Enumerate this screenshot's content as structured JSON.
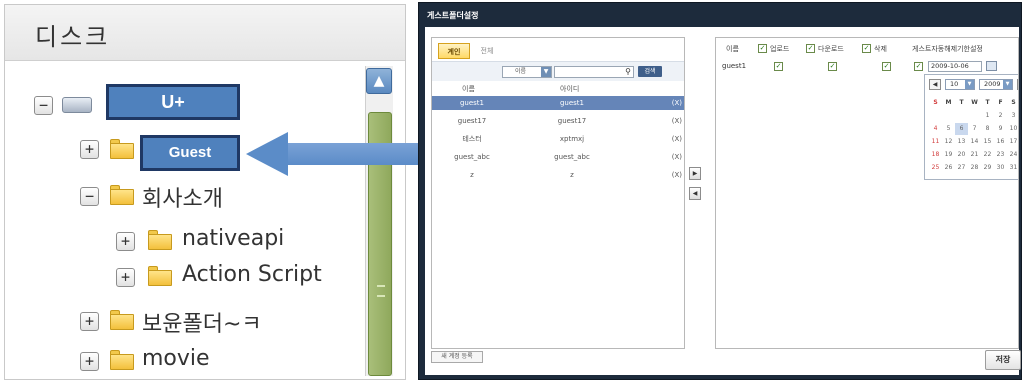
{
  "disk_panel": {
    "title": "디스크",
    "tree": [
      {
        "label": "",
        "state": "collapse"
      },
      {
        "label": "",
        "state": "expand"
      },
      {
        "label": "회사소개",
        "state": "collapse"
      },
      {
        "label": "nativeapi",
        "state": "expand"
      },
      {
        "label": "Action Script",
        "state": "expand"
      },
      {
        "label": "보윤폴더~ㅋ",
        "state": "expand"
      },
      {
        "label": "movie",
        "state": "expand"
      }
    ],
    "callouts": {
      "drive": "U+",
      "guest": "Guest"
    }
  },
  "dialog": {
    "title": "게스트폴더설정",
    "tabs": {
      "user": "계인",
      "all": "전체"
    },
    "search": {
      "field_select": "이름",
      "placeholder": "",
      "button": "검색"
    },
    "columns": {
      "name": "이름",
      "id": "아이디"
    },
    "users": [
      {
        "name": "guest1",
        "id": "guest1",
        "x": "(X)"
      },
      {
        "name": "guest17",
        "id": "guest17",
        "x": "(X)"
      },
      {
        "name": "테스터",
        "id": "xptmxj",
        "x": "(X)"
      },
      {
        "name": "guest_abc",
        "id": "guest_abc",
        "x": "(X)"
      },
      {
        "name": "z",
        "id": "z",
        "x": "(X)"
      }
    ],
    "new_account_button": "새 계정 등록",
    "permissions": {
      "columns": {
        "name": "이름",
        "upload": "업로드",
        "download": "다운로드",
        "delete": "삭제",
        "auto_delete": "게스트자동해제기한설정"
      },
      "row_user": "guest1",
      "date": "2009-10-06"
    },
    "calendar": {
      "month": "10",
      "year": "2009",
      "weekdays": [
        "S",
        "M",
        "T",
        "W",
        "T",
        "F",
        "S"
      ],
      "weeks": [
        [
          "",
          "",
          "",
          "",
          "1",
          "2",
          "3"
        ],
        [
          "4",
          "5",
          "6",
          "7",
          "8",
          "9",
          "10"
        ],
        [
          "11",
          "12",
          "13",
          "14",
          "15",
          "16",
          "17"
        ],
        [
          "18",
          "19",
          "20",
          "21",
          "22",
          "23",
          "24"
        ],
        [
          "25",
          "26",
          "27",
          "28",
          "29",
          "30",
          "31"
        ]
      ],
      "today": "6"
    },
    "save_button": "저장"
  },
  "colors": {
    "dialog_frame": "#1d2b3c",
    "selected_row": "#6585b8",
    "callout_fill": "#4f81bd",
    "callout_border": "#1f3864",
    "scroll_thumb": "#9bb26a"
  }
}
